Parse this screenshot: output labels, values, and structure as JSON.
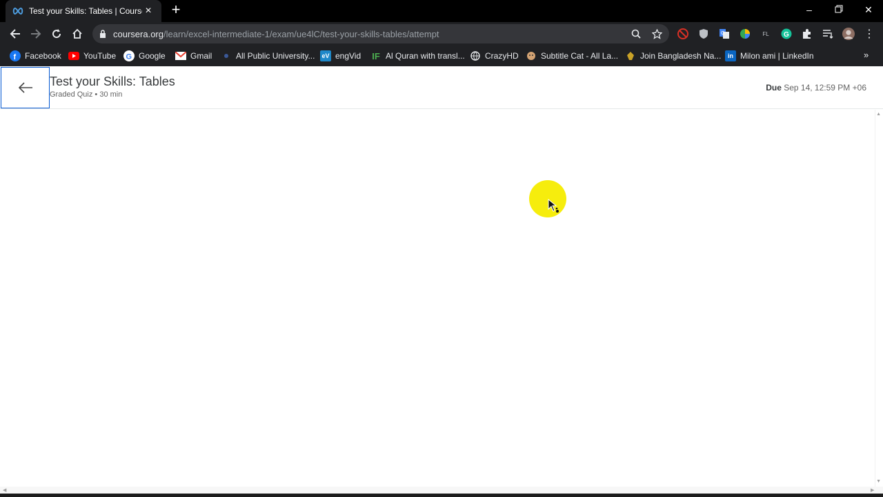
{
  "browser": {
    "tab": {
      "title": "Test your Skills: Tables | Coursera",
      "favicon": "coursera-infinity-icon"
    },
    "url": {
      "host": "coursera.org",
      "path": "/learn/excel-intermediate-1/exam/ue4lC/test-your-skills-tables/attempt"
    },
    "bookmarks": [
      {
        "label": "Facebook",
        "icon": "facebook-icon",
        "color": "#1877f2"
      },
      {
        "label": "YouTube",
        "icon": "youtube-icon",
        "color": "#ff0000"
      },
      {
        "label": "Google",
        "icon": "google-icon",
        "color": "#ffffff"
      },
      {
        "label": "Gmail",
        "icon": "gmail-icon",
        "color": "#ea4335"
      },
      {
        "label": "All Public University...",
        "icon": "university-icon",
        "color": "#3b5998"
      },
      {
        "label": "engVid",
        "icon": "engvid-icon",
        "color": "#1e88c9"
      },
      {
        "label": "Al Quran with transl...",
        "icon": "quran-icon",
        "color": "#4caf50"
      },
      {
        "label": "CrazyHD",
        "icon": "globe-icon",
        "color": "#e8eaed"
      },
      {
        "label": "Subtitle Cat - All La...",
        "icon": "subtitle-cat-icon",
        "color": "#d4a373"
      },
      {
        "label": "Join Bangladesh Na...",
        "icon": "navy-icon",
        "color": "#c9a227"
      },
      {
        "label": "Milon ami | LinkedIn",
        "icon": "linkedin-icon",
        "color": "#0a66c2"
      }
    ]
  },
  "header": {
    "title": "Test your Skills: Tables",
    "meta": "Graded Quiz • 30 min",
    "due_label": "Due",
    "due_value": "Sep 14, 12:59 PM +06"
  },
  "colors": {
    "accent": "#0056d2",
    "cursor_highlight": "#f5ec00"
  }
}
